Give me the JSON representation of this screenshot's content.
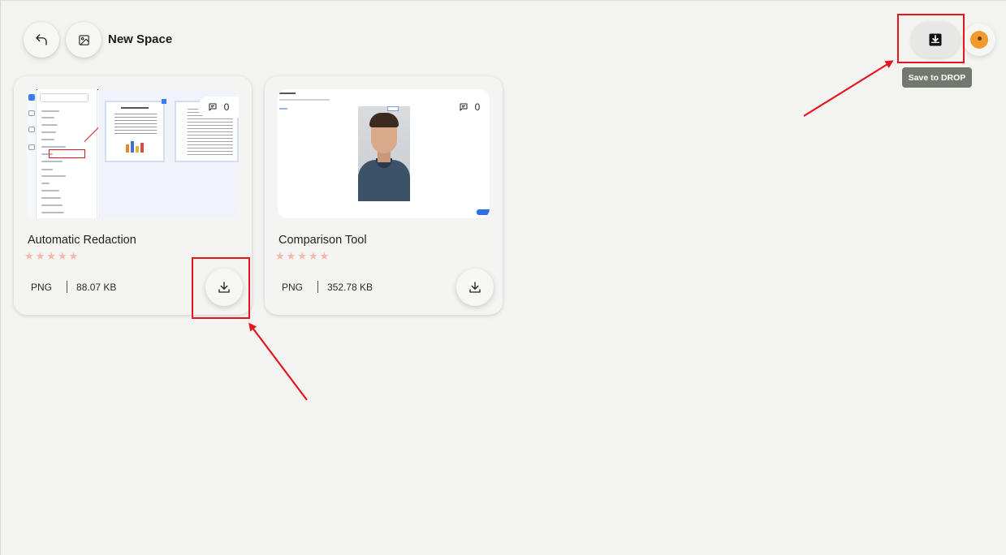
{
  "header": {
    "title": "New Space",
    "tooltip": "Save to DROP"
  },
  "cards": [
    {
      "title": "Automatic Redaction",
      "comment_count": "0",
      "rating_stars": 5,
      "format": "PNG",
      "size": "88.07 KB"
    },
    {
      "title": "Comparison Tool",
      "comment_count": "0",
      "rating_stars": 5,
      "format": "PNG",
      "size": "352.78 KB"
    }
  ],
  "colors": {
    "background": "#f3f3f2",
    "annotation": "#e6141b",
    "tooltip_bg": "#73786f",
    "star": "#f3b8ab",
    "avatar": "#f29a2e"
  }
}
